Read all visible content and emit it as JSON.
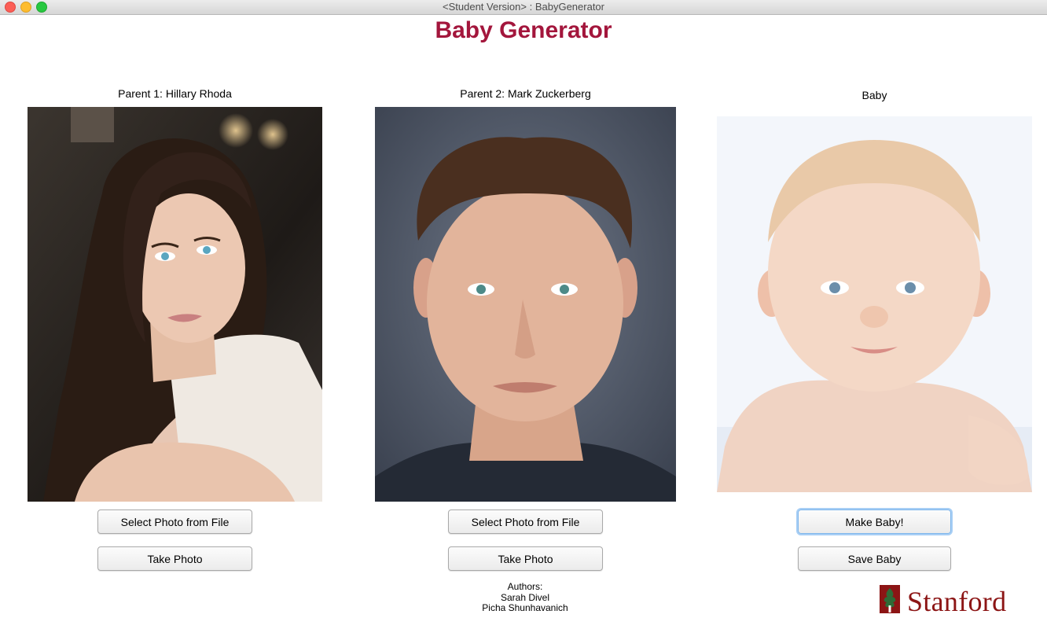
{
  "window": {
    "title": "<Student Version> : BabyGenerator"
  },
  "app": {
    "title": "Baby Generator"
  },
  "parent1": {
    "label": "Parent 1: Hillary Rhoda",
    "select_button": "Select Photo from File",
    "take_button": "Take Photo"
  },
  "parent2": {
    "label": "Parent 2: Mark Zuckerberg",
    "select_button": "Select Photo from File",
    "take_button": "Take Photo"
  },
  "baby": {
    "label": "Baby",
    "make_button": "Make Baby!",
    "save_button": "Save Baby"
  },
  "footer": {
    "authors_heading": "Authors:",
    "author1": "Sarah Divel",
    "author2": "Picha Shunhavanich",
    "logo_text": "Stanford"
  },
  "colors": {
    "title": "#a3163c",
    "stanford": "#8c1515"
  }
}
